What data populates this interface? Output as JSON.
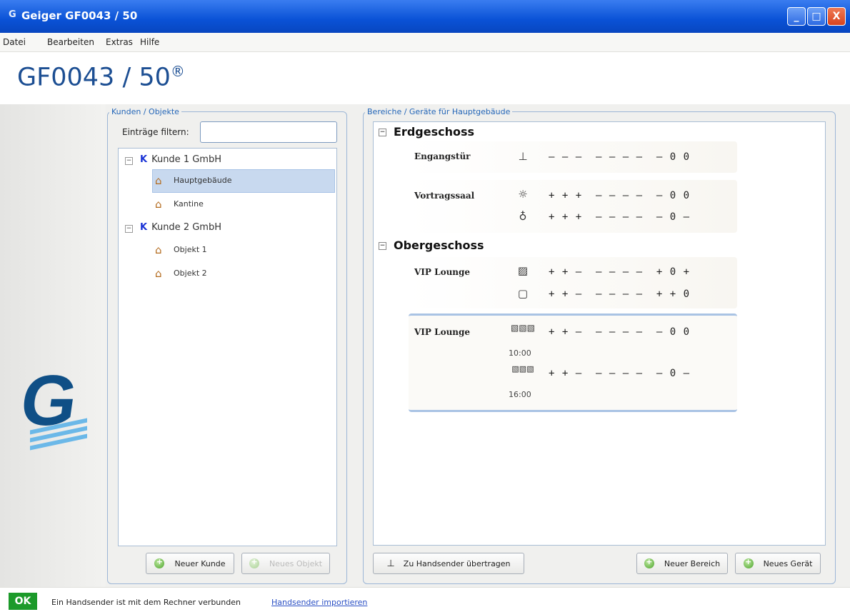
{
  "window": {
    "logo_glyph": "G",
    "title": "Geiger GF0043 / 50",
    "minimize": "_",
    "maximize": "□",
    "close": "X"
  },
  "menu": [
    "Datei",
    "Bearbeiten",
    "Extras",
    "Hilfe"
  ],
  "app": {
    "title": "GF0043 / 50",
    "reg": "®",
    "brand_glyph": "G"
  },
  "customers": {
    "legend": "Kunden / Objekte",
    "filter_label": "Einträge filtern:",
    "filter_value": "",
    "tree": [
      {
        "label": "Kunde 1 GmbH",
        "badge": "K",
        "objects": [
          "Hauptgebäude",
          "Kantine"
        ]
      },
      {
        "label": "Kunde 2 GmbH",
        "badge": "K",
        "objects": [
          "Objekt 1",
          "Objekt 2"
        ]
      }
    ],
    "selected": "Hauptgebäude",
    "btn_new_customer": "Neuer Kunde",
    "btn_new_object": "Neues Objekt"
  },
  "areas": {
    "legend": "Bereiche / Geräte für Hauptgebäude",
    "sections": [
      {
        "name": "Erdgeschoss",
        "expander": "−"
      },
      {
        "name": "Obergeschoss",
        "expander": "−"
      }
    ],
    "rooms": [
      {
        "name": "Engangstür",
        "devices": [
          {
            "icon": "antenna-icon",
            "state": "– – –  – – – –  – 0 0"
          }
        ]
      },
      {
        "name": "Vortragssaal",
        "devices": [
          {
            "icon": "lamp-on-icon",
            "state": "+ + +  – – – –  – 0 0"
          },
          {
            "icon": "lamp-icon",
            "state": "+ + +  – – – –  – 0 –"
          }
        ]
      },
      {
        "name": "VIP Lounge",
        "devices": [
          {
            "icon": "window-tilted-icon",
            "state": "+ + –  – – – –  + 0 +"
          },
          {
            "icon": "window-icon",
            "state": "+ + –  – – – –  + + 0"
          }
        ]
      },
      {
        "name": "VIP Lounge",
        "devices": [
          {
            "icon": "awning-icon",
            "state": "+ + –  – – – –  – 0 0",
            "time": "10:00"
          },
          {
            "icon": "awning-icon",
            "state": "+ + –  – – – –  – 0 –",
            "time": "16:00"
          }
        ]
      }
    ],
    "btn_transfer": "Zu Handsender übertragen",
    "btn_new_area": "Neuer Bereich",
    "btn_new_device": "Neues Gerät"
  },
  "status": {
    "ok": "OK",
    "message": "Ein Handsender ist mit dem Rechner verbunden",
    "link": "Handsender importieren"
  }
}
